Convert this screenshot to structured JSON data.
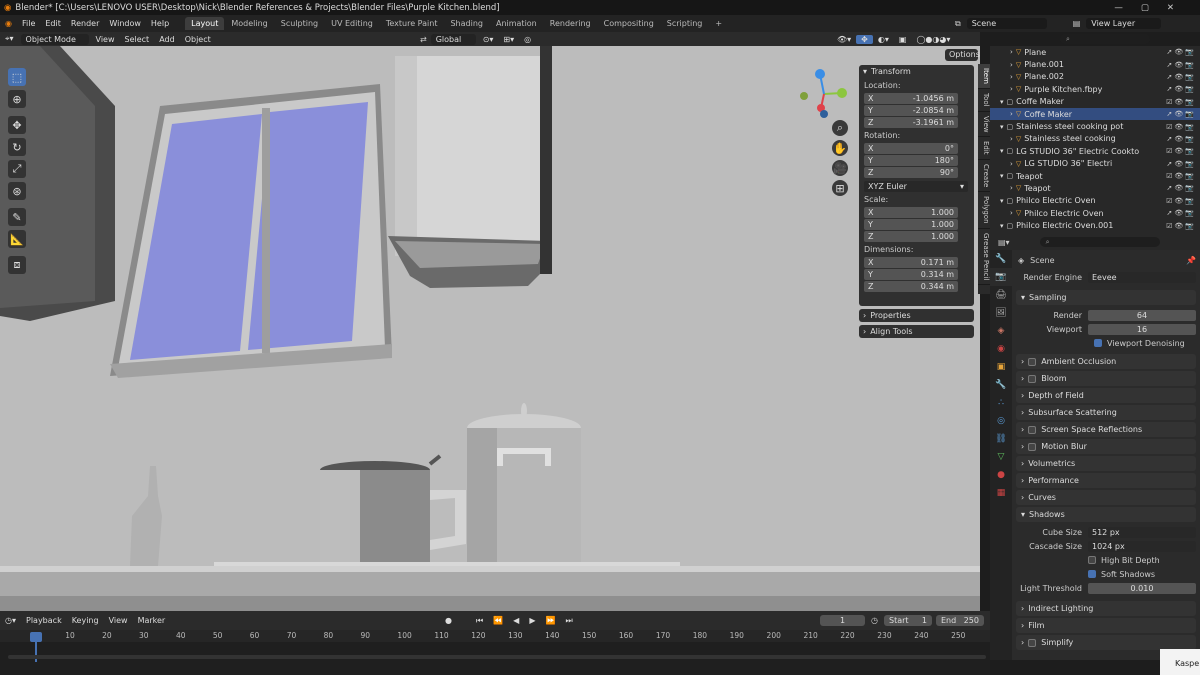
{
  "title": "Blender* [C:\\Users\\LENOVO USER\\Desktop\\Nick\\Blender References & Projects\\Blender Files\\Purple Kitchen.blend]",
  "menu": [
    "File",
    "Edit",
    "Render",
    "Window",
    "Help"
  ],
  "workspaces": [
    "Layout",
    "Modeling",
    "Sculpting",
    "UV Editing",
    "Texture Paint",
    "Shading",
    "Animation",
    "Rendering",
    "Compositing",
    "Scripting"
  ],
  "scene": "Scene",
  "view_layer": "View Layer",
  "header": {
    "mode": "Object Mode",
    "view": "View",
    "select": "Select",
    "add": "Add",
    "object": "Object",
    "orientation": "Global",
    "options": "Options"
  },
  "transform": {
    "title": "Transform",
    "location_label": "Location:",
    "location": [
      {
        "ax": "X",
        "v": "-1.0456 m"
      },
      {
        "ax": "Y",
        "v": "-2.0854 m"
      },
      {
        "ax": "Z",
        "v": "-3.1961 m"
      }
    ],
    "rotation_label": "Rotation:",
    "rotation": [
      {
        "ax": "X",
        "v": "0°"
      },
      {
        "ax": "Y",
        "v": "180°"
      },
      {
        "ax": "Z",
        "v": "90°"
      }
    ],
    "rotation_mode": "XYZ Euler",
    "scale_label": "Scale:",
    "scale": [
      {
        "ax": "X",
        "v": "1.000"
      },
      {
        "ax": "Y",
        "v": "1.000"
      },
      {
        "ax": "Z",
        "v": "1.000"
      }
    ],
    "dimensions_label": "Dimensions:",
    "dimensions": [
      {
        "ax": "X",
        "v": "0.171 m"
      },
      {
        "ax": "Y",
        "v": "0.314 m"
      },
      {
        "ax": "Z",
        "v": "0.344 m"
      }
    ],
    "properties": "Properties",
    "align_tools": "Align Tools"
  },
  "side_tabs": [
    "Item",
    "Tool",
    "View",
    "Edit",
    "Create",
    "Polygon",
    "Grease Pencil"
  ],
  "outliner": [
    {
      "indent": 1,
      "name": "Plane"
    },
    {
      "indent": 1,
      "name": "Plane.001"
    },
    {
      "indent": 1,
      "name": "Plane.002"
    },
    {
      "indent": 1,
      "name": "Purple Kitchen.fbpy"
    },
    {
      "indent": 0,
      "name": "Coffe Maker"
    },
    {
      "indent": 1,
      "name": "Coffe Maker",
      "sel": true
    },
    {
      "indent": 0,
      "name": "Stainless steel cooking pot"
    },
    {
      "indent": 1,
      "name": "Stainless steel cooking"
    },
    {
      "indent": 0,
      "name": "LG STUDIO 36\" Electric Cookto"
    },
    {
      "indent": 1,
      "name": "LG STUDIO 36\" Electri"
    },
    {
      "indent": 0,
      "name": "Teapot"
    },
    {
      "indent": 1,
      "name": "Teapot"
    },
    {
      "indent": 0,
      "name": "Philco Electric Oven"
    },
    {
      "indent": 1,
      "name": "Philco Electric Oven"
    },
    {
      "indent": 0,
      "name": "Philco Electric Oven.001"
    }
  ],
  "properties": {
    "scene": "Scene",
    "render_engine_label": "Render Engine",
    "render_engine": "Eevee",
    "sampling": "Sampling",
    "render_label": "Render",
    "render_value": "64",
    "viewport_label": "Viewport",
    "viewport_value": "16",
    "viewport_denoising": "Viewport Denoising",
    "sections": [
      "Ambient Occlusion",
      "Bloom",
      "Depth of Field",
      "Subsurface Scattering",
      "Screen Space Reflections",
      "Motion Blur",
      "Volumetrics",
      "Performance",
      "Curves"
    ],
    "shadows": "Shadows",
    "cube_size_label": "Cube Size",
    "cube_size": "512 px",
    "cascade_size_label": "Cascade Size",
    "cascade_size": "1024 px",
    "high_bit_depth": "High Bit Depth",
    "soft_shadows": "Soft Shadows",
    "light_threshold_label": "Light Threshold",
    "light_threshold": "0.010",
    "after": [
      "Indirect Lighting",
      "Film",
      "Simplify"
    ]
  },
  "timeline": {
    "playback": "Playback",
    "keying": "Keying",
    "view": "View",
    "marker": "Marker",
    "current": "1",
    "start_label": "Start",
    "start": "1",
    "end_label": "End",
    "end": "250",
    "ticks": [
      "1",
      "10",
      "20",
      "30",
      "40",
      "50",
      "60",
      "70",
      "80",
      "90",
      "100",
      "110",
      "120",
      "130",
      "140",
      "150",
      "160",
      "170",
      "180",
      "190",
      "200",
      "210",
      "220",
      "230",
      "240",
      "250"
    ]
  },
  "taskbar_popup": "Kaspe"
}
